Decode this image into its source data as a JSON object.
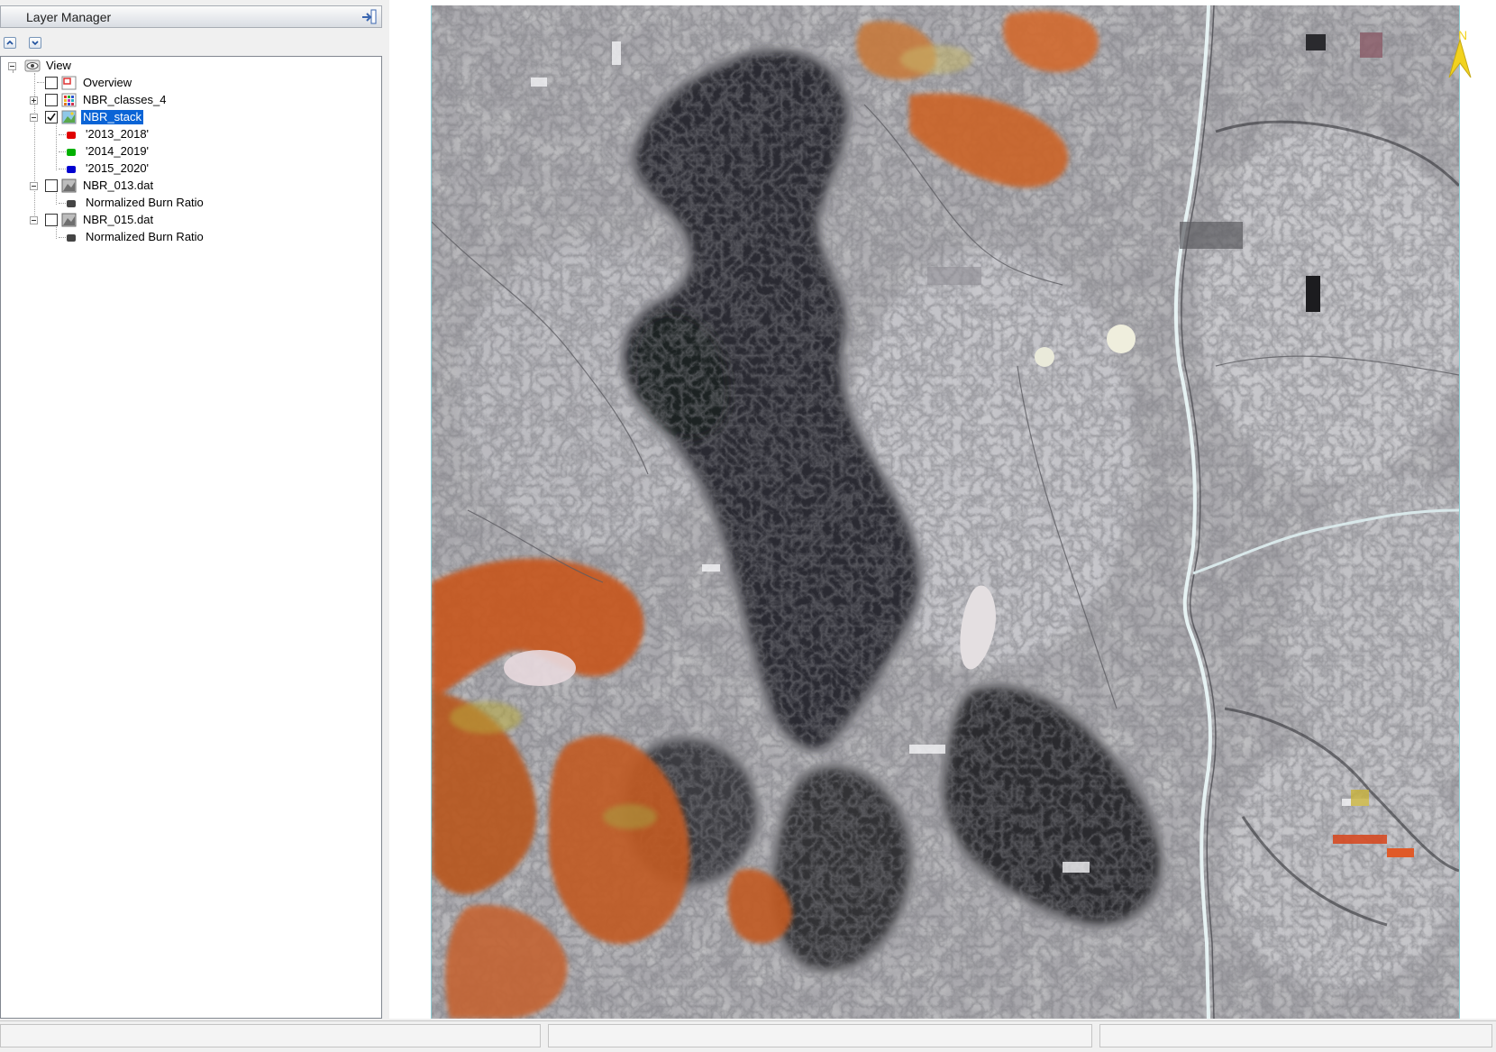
{
  "panel": {
    "title": "Layer Manager",
    "pin_icon": "pin-icon",
    "toolbar": {
      "move_up_icon": "arrow-up-icon",
      "move_down_icon": "arrow-down-icon"
    }
  },
  "tree": {
    "root": {
      "label": "View",
      "icon": "eye-icon"
    },
    "layers": [
      {
        "label": "Overview",
        "icon": "overview-icon",
        "checked": false
      },
      {
        "label": "NBR_classes_4",
        "icon": "classification-icon",
        "checked": false
      },
      {
        "label": "NBR_stack",
        "icon": "rgb-image-icon",
        "checked": true,
        "selected": true,
        "bands": [
          {
            "label": "'2013_2018'",
            "color": "#e00000"
          },
          {
            "label": "'2014_2019'",
            "color": "#00b000"
          },
          {
            "label": "'2015_2020'",
            "color": "#0000d0"
          }
        ]
      },
      {
        "label": "NBR_013.dat",
        "icon": "grayscale-image-icon",
        "checked": false,
        "bands": [
          {
            "label": "Normalized Burn Ratio",
            "color": "#444444"
          }
        ]
      },
      {
        "label": "NBR_015.dat",
        "icon": "grayscale-image-icon",
        "checked": false,
        "bands": [
          {
            "label": "Normalized Burn Ratio",
            "color": "#444444"
          }
        ]
      }
    ]
  },
  "view": {
    "image": "NBR_stack false-color composite",
    "north_label": "N",
    "north_arrow_icon": "north-arrow-icon",
    "colors": {
      "north_arrow": "#f2d21e",
      "burn_dark": "#2a2b2e",
      "highlight_orange": "#c8561e"
    }
  },
  "status": {
    "panes": [
      "",
      "",
      ""
    ]
  }
}
